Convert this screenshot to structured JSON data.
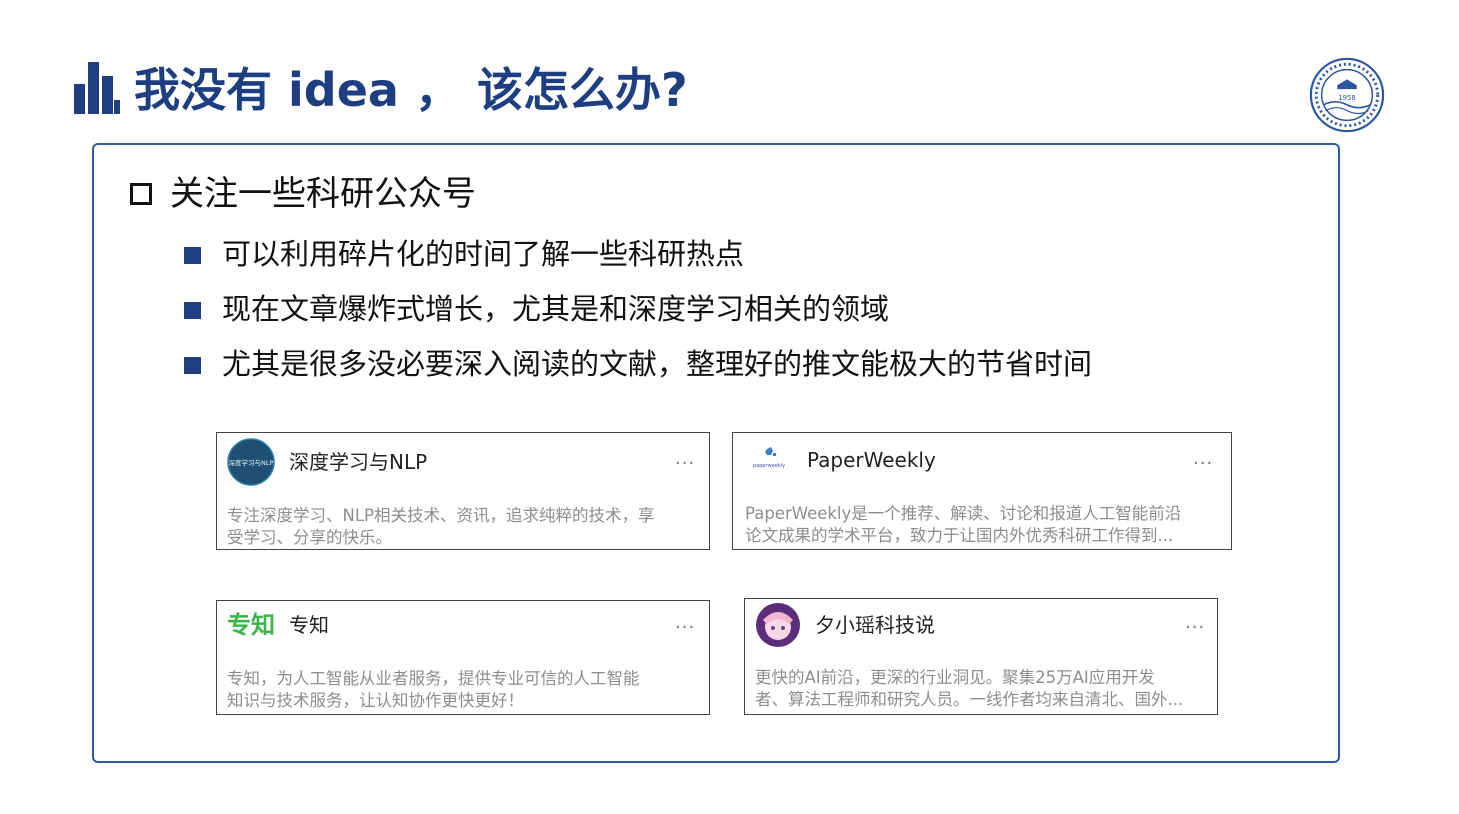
{
  "title": "我没有 idea ， 该怎么办?",
  "heading": "关注一些科研公众号",
  "bullets": [
    "可以利用碎片化的时间了解一些科研热点",
    "现在文章爆炸式增长，尤其是和深度学习相关的领域",
    "尤其是很多没必要深入阅读的文献，整理好的推文能极大的节省时间"
  ],
  "cards": [
    {
      "name": "深度学习与NLP",
      "avatar_text": "深度学习与NLP",
      "more": "···",
      "desc_line1": "专注深度学习、NLP相关技术、资讯，追求纯粹的技术，享",
      "desc_line2": "受学习、分享的快乐。"
    },
    {
      "name": "PaperWeekly",
      "avatar_text": "paperweekly",
      "more": "···",
      "desc_line1": "PaperWeekly是一个推荐、解读、讨论和报道人工智能前沿",
      "desc_line2": "论文成果的学术平台，致力于让国内外优秀科研工作得到..."
    },
    {
      "name": "专知",
      "avatar_text": "专知",
      "more": "···",
      "desc_line1": "专知，为人工智能从业者服务，提供专业可信的人工智能",
      "desc_line2": "知识与技术服务，让认知协作更快更好！"
    },
    {
      "name": "夕小瑶科技说",
      "more": "···",
      "desc_line1": "更快的AI前沿，更深的行业洞见。聚集25万AI应用开发",
      "desc_line2": "者、算法工程师和研究人员。一线作者均来自清北、国外..."
    }
  ],
  "logo": {
    "year": "1958",
    "color": "#2a55a0"
  },
  "colors": {
    "title": "#1d3f82",
    "panel_border": "#2f5aa3",
    "bullet": "#1d3f82",
    "zhuanzhi_green": "#3ab54a"
  }
}
